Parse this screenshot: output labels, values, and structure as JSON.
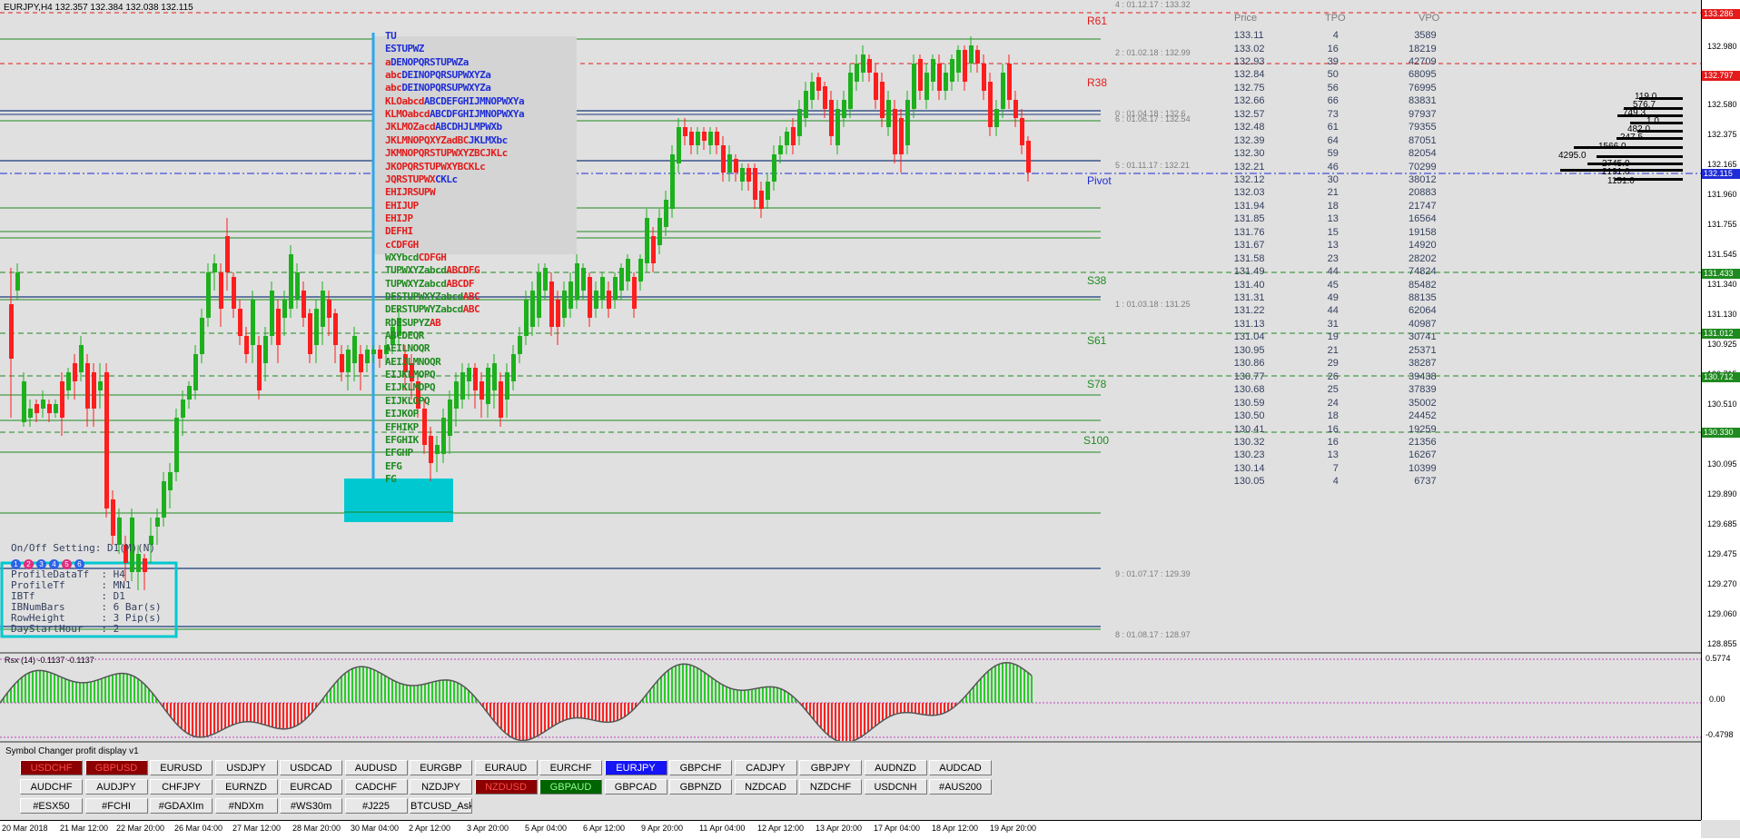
{
  "chart": {
    "title": "EURJPY,H4  132.357 132.384 132.038 132.115",
    "price_labels": [
      "132.980",
      "132.580",
      "132.375",
      "132.165",
      "131.960",
      "131.755",
      "131.545",
      "131.340",
      "131.130",
      "130.925",
      "130.715",
      "130.510",
      "130.305",
      "130.095",
      "129.890",
      "129.685",
      "129.475",
      "129.270",
      "129.060",
      "128.855"
    ],
    "price_tags": [
      {
        "text": "133.286",
        "color": "#e21b1b"
      },
      {
        "text": "132.797",
        "color": "#e21b1b"
      },
      {
        "text": "132.115",
        "color": "#1f2dd6"
      },
      {
        "text": "131.433",
        "color": "#1f8a1f"
      },
      {
        "text": "131.012",
        "color": "#1f8a1f"
      },
      {
        "text": "130.712",
        "color": "#1f8a1f"
      },
      {
        "text": "130.330",
        "color": "#1f8a1f"
      }
    ],
    "time_labels": [
      "20 Mar 2018",
      "21 Mar 12:00",
      "22 Mar 20:00",
      "26 Mar 04:00",
      "27 Mar 12:00",
      "28 Mar 20:00",
      "30 Mar 04:00",
      "2 Apr 12:00",
      "3 Apr 20:00",
      "5 Apr 04:00",
      "6 Apr 12:00",
      "9 Apr 20:00",
      "11 Apr 04:00",
      "12 Apr 12:00",
      "13 Apr 20:00",
      "17 Apr 04:00",
      "18 Apr 12:00",
      "19 Apr 20:00"
    ],
    "levels": {
      "r61": "R61",
      "r38": "R38",
      "pivot": "Pivot",
      "s38": "S38",
      "s61": "S61",
      "s78": "S78",
      "s100": "S100"
    },
    "level_notes": [
      "4 : 01.12.17 : 133.32",
      "2 : 01.02.18 : 132.99",
      "0 : 01.04.18 : 132.6",
      "6 : 01.06.17 : 132.54",
      "5 : 01.11.17 : 132.21",
      "1 : 01.03.18 : 131.25",
      "9 : 01.07.17 : 129.39",
      "8 : 01.08.17 : 128.97"
    ],
    "volume_profile": [
      "119.0",
      "576.7",
      "749.3",
      "1.0",
      "482.0",
      "247.5",
      "1566.0",
      "4295.0",
      "2745.0",
      "2191.0",
      "1151.0"
    ]
  },
  "profile_table": {
    "headers": [
      "Price",
      "TPO",
      "VPO"
    ],
    "rows": [
      [
        "133.11",
        "4",
        "3589"
      ],
      [
        "133.02",
        "16",
        "18219"
      ],
      [
        "132.93",
        "39",
        "42709"
      ],
      [
        "132.84",
        "50",
        "68095"
      ],
      [
        "132.75",
        "56",
        "76995"
      ],
      [
        "132.66",
        "66",
        "83831"
      ],
      [
        "132.57",
        "73",
        "97937"
      ],
      [
        "132.48",
        "61",
        "79355"
      ],
      [
        "132.39",
        "64",
        "87051"
      ],
      [
        "132.30",
        "59",
        "82054"
      ],
      [
        "132.21",
        "46",
        "70299"
      ],
      [
        "132.12",
        "30",
        "38012"
      ],
      [
        "132.03",
        "21",
        "20883"
      ],
      [
        "131.94",
        "18",
        "21747"
      ],
      [
        "131.85",
        "13",
        "16564"
      ],
      [
        "131.76",
        "15",
        "19158"
      ],
      [
        "131.67",
        "13",
        "14920"
      ],
      [
        "131.58",
        "23",
        "28202"
      ],
      [
        "131.49",
        "44",
        "74824"
      ],
      [
        "131.40",
        "45",
        "85482"
      ],
      [
        "131.31",
        "49",
        "88135"
      ],
      [
        "131.22",
        "44",
        "62064"
      ],
      [
        "131.13",
        "31",
        "40987"
      ],
      [
        "131.04",
        "19",
        "30741"
      ],
      [
        "130.95",
        "21",
        "25371"
      ],
      [
        "130.86",
        "29",
        "38287"
      ],
      [
        "130.77",
        "26",
        "39438"
      ],
      [
        "130.68",
        "25",
        "37839"
      ],
      [
        "130.59",
        "24",
        "35002"
      ],
      [
        "130.50",
        "18",
        "24452"
      ],
      [
        "130.41",
        "16",
        "19259"
      ],
      [
        "130.32",
        "16",
        "21356"
      ],
      [
        "130.23",
        "13",
        "16267"
      ],
      [
        "130.14",
        "7",
        "10399"
      ],
      [
        "130.05",
        "4",
        "6737"
      ]
    ]
  },
  "market_profile": {
    "rows": [
      {
        "segs": [
          [
            "TU",
            "#1f2dd6"
          ]
        ]
      },
      {
        "segs": [
          [
            "ESTUPWZ",
            "#1f2dd6"
          ]
        ]
      },
      {
        "segs": [
          [
            "a",
            "#e21b1b"
          ],
          [
            "DENOPQRSTUPWZa",
            "#1f2dd6"
          ]
        ]
      },
      {
        "segs": [
          [
            "abc",
            "#e21b1b"
          ],
          [
            "DEINOPQRSUPWXYZa",
            "#1f2dd6"
          ]
        ]
      },
      {
        "segs": [
          [
            "abc",
            "#e21b1b"
          ],
          [
            "DEINOPQRSUPWXYZa",
            "#1f2dd6"
          ]
        ]
      },
      {
        "segs": [
          [
            "KLOabcd",
            "#e21b1b"
          ],
          [
            "ABCDEFGHIJMNOPWXYa",
            "#1f2dd6"
          ]
        ]
      },
      {
        "segs": [
          [
            "KLMOabcd",
            "#e21b1b"
          ],
          [
            "ABCDFGHIJMNOPWXYa",
            "#1f2dd6"
          ]
        ]
      },
      {
        "segs": [
          [
            "JKLMOZacd",
            "#e21b1b"
          ],
          [
            "ABCDHJLMPWXb",
            "#1f2dd6"
          ]
        ]
      },
      {
        "segs": [
          [
            "JKLMNOPQXYZadBC",
            "#e21b1b"
          ],
          [
            "JKLMXbc",
            "#1f2dd6"
          ]
        ]
      },
      {
        "segs": [
          [
            "JKMNOPQRSTUPWXYZBCJKLc",
            "#e21b1b"
          ]
        ]
      },
      {
        "segs": [
          [
            "JKOPQRSTUPWXYBCKLc",
            "#e21b1b"
          ]
        ]
      },
      {
        "segs": [
          [
            "JQRSTUPWX",
            "#e21b1b"
          ],
          [
            "CKLc",
            "#1f2dd6"
          ]
        ]
      },
      {
        "segs": [
          [
            "EHIJRSUPW",
            "#e21b1b"
          ]
        ]
      },
      {
        "segs": [
          [
            "EHIJUP",
            "#e21b1b"
          ]
        ]
      },
      {
        "segs": [
          [
            "EHIJP",
            "#e21b1b"
          ]
        ]
      },
      {
        "segs": [
          [
            "DEFHI",
            "#e21b1b"
          ]
        ]
      },
      {
        "segs": [
          [
            "cCDFGH",
            "#e21b1b"
          ]
        ]
      },
      {
        "segs": [
          [
            "WXYbcd",
            "#1f8a1f"
          ],
          [
            "CDFGH",
            "#e21b1b"
          ]
        ]
      },
      {
        "segs": [
          [
            "TUPWXYZabcd",
            "#1f8a1f"
          ],
          [
            "ABCDFG",
            "#e21b1b"
          ]
        ]
      },
      {
        "segs": [
          [
            "TUPWXYZabcd",
            "#1f8a1f"
          ],
          [
            "ABCDF",
            "#e21b1b"
          ]
        ]
      },
      {
        "segs": [
          [
            "DESTUPWXYZabcd",
            "#1f8a1f"
          ],
          [
            "ABC",
            "#e21b1b"
          ]
        ]
      },
      {
        "segs": [
          [
            "DERSTUPWYZabcd",
            "#1f8a1f"
          ],
          [
            "ABC",
            "#e21b1b"
          ]
        ]
      },
      {
        "segs": [
          [
            "RDESUPYZ",
            "#1f8a1f"
          ],
          [
            "AB",
            "#e21b1b"
          ]
        ]
      },
      {
        "segs": [
          [
            "ABCDEQR",
            "#1f8a1f"
          ]
        ]
      },
      {
        "segs": [
          [
            "AEILNOQR",
            "#1f8a1f"
          ]
        ]
      },
      {
        "segs": [
          [
            "AEIJLMNOQR",
            "#1f8a1f"
          ]
        ]
      },
      {
        "segs": [
          [
            "EIJKLMOPQ",
            "#1f8a1f"
          ]
        ]
      },
      {
        "segs": [
          [
            "EIJKLMOPQ",
            "#1f8a1f"
          ]
        ]
      },
      {
        "segs": [
          [
            "EIJKLOPQ",
            "#1f8a1f"
          ]
        ]
      },
      {
        "segs": [
          [
            "EIJKOP",
            "#1f8a1f"
          ]
        ]
      },
      {
        "segs": [
          [
            "EFHIKP",
            "#1f8a1f"
          ]
        ]
      },
      {
        "segs": [
          [
            "EFGHIK",
            "#1f8a1f"
          ]
        ]
      },
      {
        "segs": [
          [
            "EFGHP",
            "#1f8a1f"
          ]
        ]
      },
      {
        "segs": [
          [
            "EFG",
            "#1f8a1f"
          ]
        ]
      },
      {
        "segs": [
          [
            "FG",
            "#1f8a1f"
          ]
        ]
      }
    ]
  },
  "settings": {
    "title": "On/Off Setting: D1(M)(N)",
    "toggles": [
      "1",
      "2",
      "3",
      "4",
      "5",
      "6"
    ],
    "lines": [
      "ProfileDataTf  : H4",
      "ProfileTf      : MN1",
      "IBTf           : D1",
      "IBNumBars      : 6 Bar(s)",
      "RowHeight      : 3 Pip(s)",
      "DayStartHour   : 2"
    ]
  },
  "rsi": {
    "title": "Rsx (14) -0.1137 -0.1137",
    "axis": [
      "0.5774",
      "0.00",
      "-0.4798"
    ]
  },
  "symbol_changer": {
    "title": "Symbol Changer profit display v1",
    "rows": [
      [
        [
          "USDCHF",
          "red"
        ],
        [
          "GBPUSD",
          "red"
        ],
        [
          "EURUSD",
          ""
        ],
        [
          "USDJPY",
          ""
        ],
        [
          "USDCAD",
          ""
        ],
        [
          "AUDUSD",
          ""
        ],
        [
          "EURGBP",
          ""
        ],
        [
          "EURAUD",
          ""
        ],
        [
          "EURCHF",
          ""
        ],
        [
          "EURJPY",
          "blue"
        ],
        [
          "GBPCHF",
          ""
        ],
        [
          "CADJPY",
          ""
        ],
        [
          "GBPJPY",
          ""
        ],
        [
          "AUDNZD",
          ""
        ],
        [
          "AUDCAD",
          ""
        ]
      ],
      [
        [
          "AUDCHF",
          ""
        ],
        [
          "AUDJPY",
          ""
        ],
        [
          "CHFJPY",
          ""
        ],
        [
          "EURNZD",
          ""
        ],
        [
          "EURCAD",
          ""
        ],
        [
          "CADCHF",
          ""
        ],
        [
          "NZDJPY",
          ""
        ],
        [
          "NZDUSD",
          "red"
        ],
        [
          "GBPAUD",
          "green"
        ],
        [
          "GBPCAD",
          ""
        ],
        [
          "GBPNZD",
          ""
        ],
        [
          "NZDCAD",
          ""
        ],
        [
          "NZDCHF",
          ""
        ],
        [
          "USDCNH",
          ""
        ],
        [
          "#AUS200",
          ""
        ]
      ],
      [
        [
          "#ESX50",
          ""
        ],
        [
          "#FCHI",
          ""
        ],
        [
          "#GDAXIm",
          ""
        ],
        [
          "#NDXm",
          ""
        ],
        [
          "#WS30m",
          ""
        ],
        [
          "#J225",
          ""
        ],
        [
          "BTCUSD_Ask",
          ""
        ]
      ]
    ]
  },
  "colors": {
    "bull": "#1db01d",
    "bear": "#ff1d1d",
    "resistance": "#e21b1b",
    "support": "#1f8a1f",
    "pivot": "#1f2dd6",
    "cyan": "#00c8d0"
  }
}
